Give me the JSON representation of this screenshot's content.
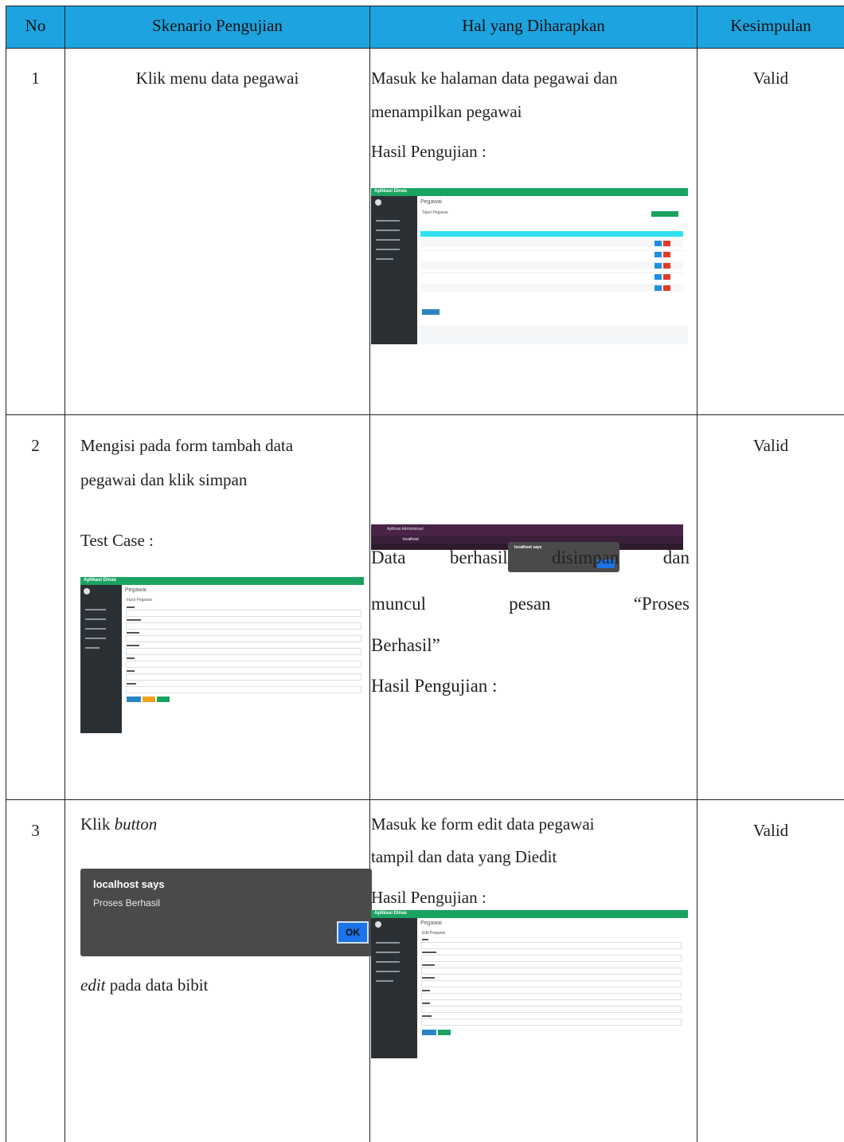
{
  "table": {
    "headers": [
      "No",
      "Skenario Pengujian",
      "Hal yang Diharapkan",
      "Kesimpulan"
    ],
    "rows": [
      {
        "no": "1",
        "scenario": "Klik menu data pegawai",
        "expected_line1": "Masuk ke halaman data pegawai dan",
        "expected_line2": "menampilkan pegawai",
        "result_label": "Hasil Pengujian :",
        "conclusion": "Valid"
      },
      {
        "no": "2",
        "scenario_line1": "Mengisi pada form tambah data",
        "scenario_line2": "pegawai dan klik simpan",
        "test_case_label": "Test Case :",
        "expected_line1": "Data berhasil disimpan dan",
        "expected_line2": "muncul pesan “Proses",
        "expected_line3": "Berhasil”",
        "result_label": "Hasil Pengujian :",
        "conclusion": "Valid"
      },
      {
        "no": "3",
        "scenario_prefix": "Klik ",
        "scenario_italic": "button",
        "scenario2_italic": "edit",
        "scenario2_rest": " pada data bibit",
        "expected_line1": "Masuk ke form edit data pegawai",
        "expected_line2": "tampil dan data yang Diedit",
        "result_label": "Hasil Pengujian :",
        "conclusion": "Valid"
      }
    ]
  },
  "screens": {
    "app_brand": "Aplikasi Dinas",
    "page_title": "Pegawai",
    "list_card_title": "Tabel Pegawai",
    "form_card_title": "Input Pegawai",
    "edit_card_title": "Edit Pegawai",
    "browser_tab": "Aplikasi Administrasi",
    "browser_url": "localhost",
    "alert_title": "localhost says",
    "alert_message": "Proses Berhasil",
    "alert_ok": "OK"
  },
  "colors": {
    "header_bg": "#1da4e0",
    "app_green": "#1aa260",
    "sidebar_dark": "#2b3035",
    "alert_bg": "#4a4a4a",
    "ok_blue": "#1a73e8"
  }
}
